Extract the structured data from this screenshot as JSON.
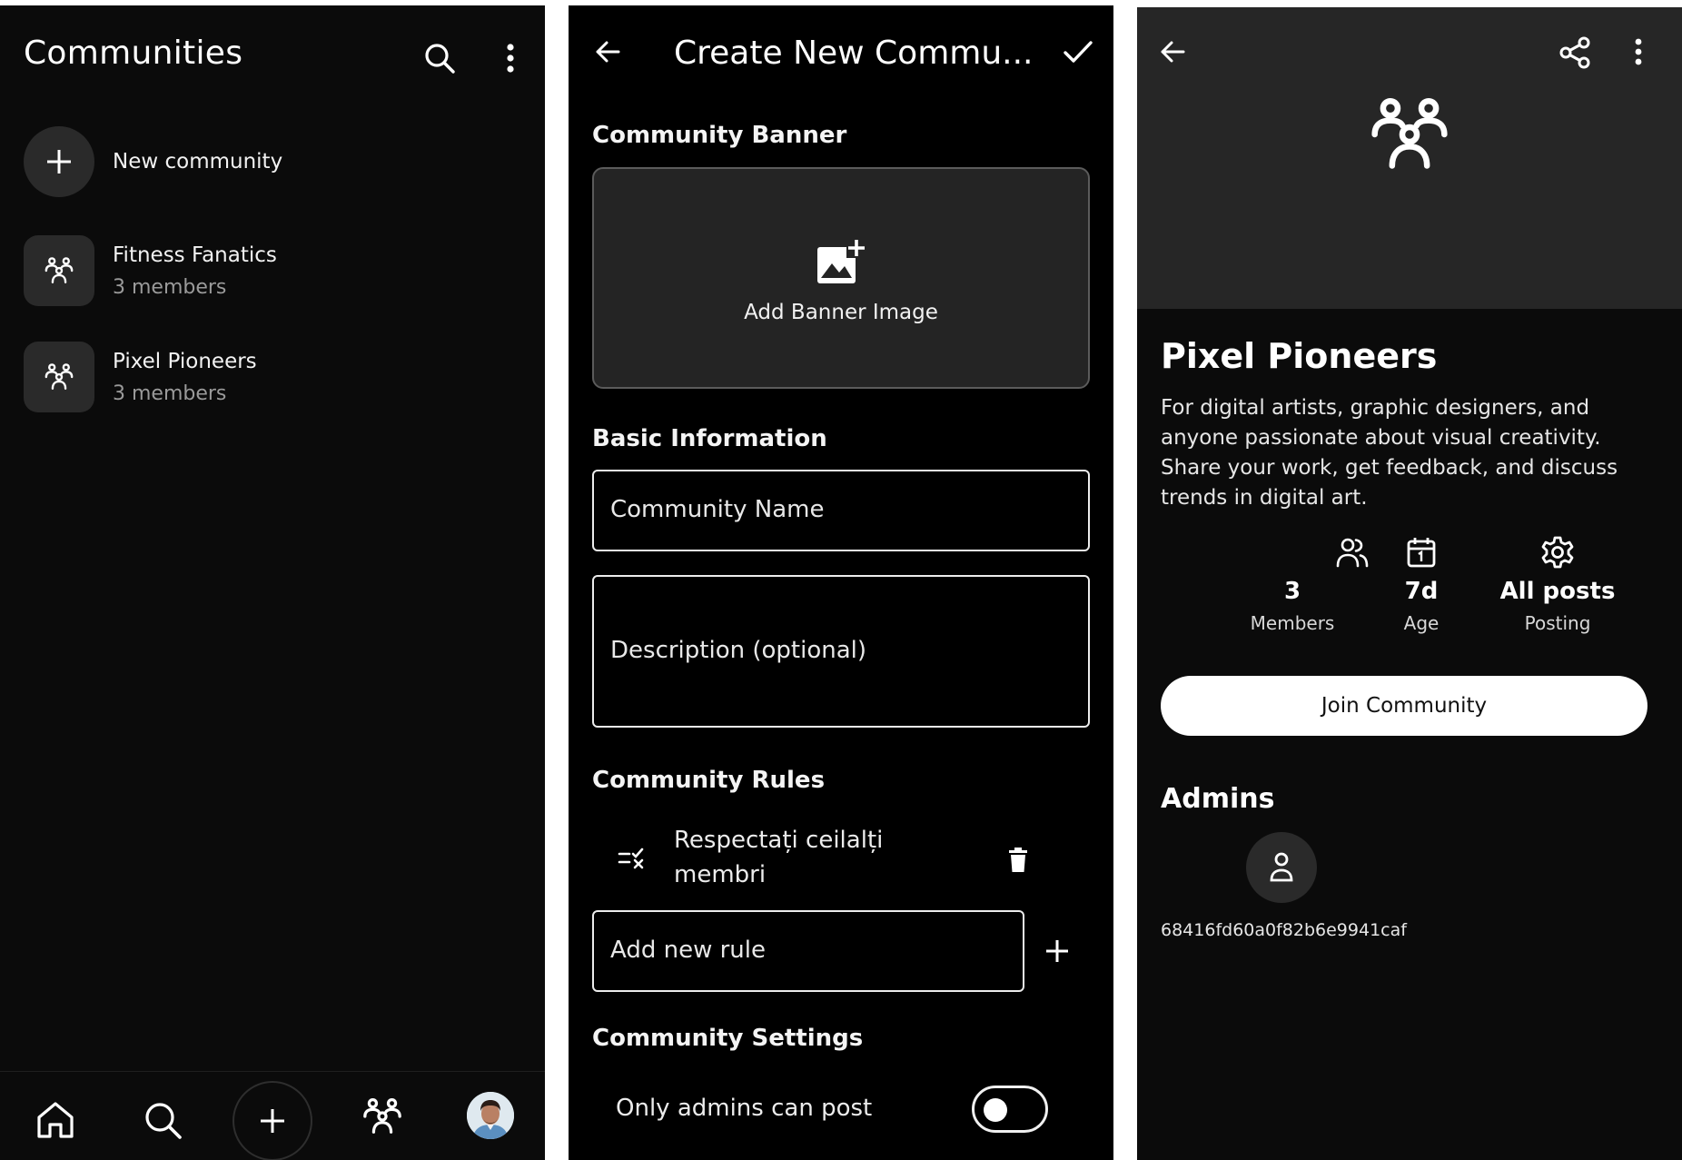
{
  "screen1": {
    "title": "Communities",
    "new_community": "New community",
    "communities": [
      {
        "name": "Fitness Fanatics",
        "members": "3 members"
      },
      {
        "name": "Pixel Pioneers",
        "members": "3 members"
      }
    ],
    "nav": [
      "home-icon",
      "search-icon",
      "plus-icon",
      "communities-icon",
      "profile-avatar"
    ]
  },
  "screen2": {
    "title": "Create New Commu...",
    "banner_section": "Community Banner",
    "banner_label": "Add Banner Image",
    "basic_section": "Basic Information",
    "name_placeholder": "Community Name",
    "description_placeholder": "Description (optional)",
    "rules_section": "Community Rules",
    "rules": [
      "Respectați ceilalți membri"
    ],
    "new_rule_placeholder": "Add new rule",
    "settings_section": "Community Settings",
    "only_admins_label": "Only admins can post",
    "only_admins_enabled": false
  },
  "screen3": {
    "title": "Pixel Pioneers",
    "description": "For digital artists, graphic designers, and anyone passionate about visual creativity. Share your work, get feedback, and discuss trends in digital art.",
    "stats": [
      {
        "icon": "users-icon",
        "value": "3",
        "label": "Members"
      },
      {
        "icon": "calendar-icon",
        "value": "7d",
        "label": "Age"
      },
      {
        "icon": "gear-icon",
        "value": "All posts",
        "label": "Posting"
      }
    ],
    "join_label": "Join Community",
    "admins_heading": "Admins",
    "admin_id": "68416fd60a0f82b6e9941caf"
  },
  "colors": {
    "background": "#0b0b0b",
    "card": "#2a2a2a",
    "text": "#ffffff",
    "muted": "#9a9a9a"
  }
}
